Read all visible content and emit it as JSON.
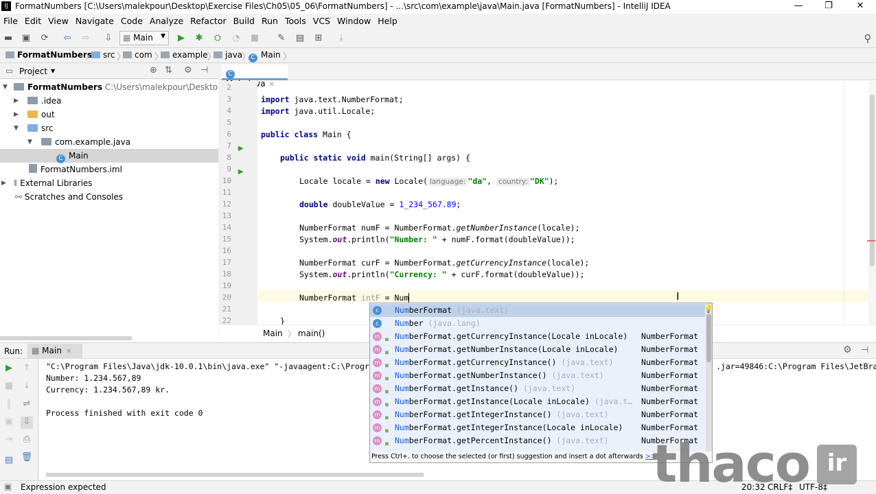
{
  "window": {
    "title": "FormatNumbers [C:\\Users\\malekpour\\Desktop\\Exercise Files\\Ch05\\05_06\\FormatNumbers] - ...\\src\\com\\example\\java\\Main.java [FormatNumbers] - IntelliJ IDEA",
    "app_icon": "IJ",
    "minimize": "—",
    "maximize": "❐",
    "close": "✕"
  },
  "menu": [
    "File",
    "Edit",
    "View",
    "Navigate",
    "Code",
    "Analyze",
    "Refactor",
    "Build",
    "Run",
    "Tools",
    "VCS",
    "Window",
    "Help"
  ],
  "toolbar": {
    "run_config": "Main"
  },
  "breadcrumb": [
    "FormatNumbers",
    "src",
    "com",
    "example",
    "java",
    "Main"
  ],
  "project": {
    "header": "Project",
    "tree": [
      {
        "label": "FormatNumbers",
        "path": "C:\\Users\\malekpour\\Desktop\\Exerc"
      },
      {
        "label": ".idea"
      },
      {
        "label": "out"
      },
      {
        "label": "src"
      },
      {
        "label": "com.example.java"
      },
      {
        "label": "Main"
      },
      {
        "label": "FormatNumbers.iml"
      },
      {
        "label": "External Libraries"
      },
      {
        "label": "Scratches and Consoles"
      }
    ]
  },
  "editor": {
    "tab": "Main.java",
    "line_numbers": [
      "2",
      "3",
      "4",
      "5",
      "6",
      "7",
      "8",
      "9",
      "10",
      "11",
      "12",
      "13",
      "14",
      "15",
      "16",
      "17",
      "18",
      "19",
      "20",
      "21",
      "22"
    ],
    "code": {
      "l3a": "import",
      "l3b": " java.text.NumberFormat;",
      "l4a": "import",
      "l4b": " java.util.Locale;",
      "l6a": "public class",
      "l6b": " Main {",
      "l8a": "public static void",
      "l8b": " main(String[] args) {",
      "l10a": "Locale locale = ",
      "l10b": "new",
      "l10c": " Locale(",
      "l10h1": "language:",
      "l10s1": "\"da\"",
      "l10d": ", ",
      "l10h2": "country:",
      "l10s2": "\"DK\"",
      "l10e": ");",
      "l12a": "double",
      "l12b": " doubleValue = ",
      "l12c": "1_234_567.89",
      "l12d": ";",
      "l14a": "NumberFormat numF = NumberFormat.",
      "l14b": "getNumberInstance",
      "l14c": "(locale);",
      "l15a": "System.",
      "l15b": "out",
      "l15c": ".println(",
      "l15d": "\"Number: \"",
      "l15e": " + numF.format(doubleValue));",
      "l17a": "NumberFormat curF = NumberFormat.",
      "l17b": "getCurrencyInstance",
      "l17c": "(locale);",
      "l18a": "System.",
      "l18b": "out",
      "l18c": ".println(",
      "l18d": "\"Currency: \"",
      "l18e": " + curF.format(doubleValue));",
      "l20a": "NumberFormat ",
      "l20b": "intF",
      "l20c": " = Num",
      "l22": "}"
    },
    "crumb": [
      "Main",
      "main()"
    ]
  },
  "completion": {
    "items": [
      {
        "hl": "Num",
        "rest": "berFormat",
        "tail": " (java.text)",
        "type": "",
        "icon": "c"
      },
      {
        "hl": "Num",
        "rest": "ber",
        "tail": " (java.lang)",
        "type": "",
        "icon": "c"
      },
      {
        "hl": "Num",
        "rest": "berFormat.getCurrencyInstance(Locale inLocale)",
        "tail": "",
        "type": "NumberFormat",
        "icon": "m"
      },
      {
        "hl": "Num",
        "rest": "berFormat.getNumberInstance(Locale inLocale)",
        "tail": "",
        "type": "NumberFormat",
        "icon": "m"
      },
      {
        "hl": "Num",
        "rest": "berFormat.getCurrencyInstance()",
        "tail": " (java.text)",
        "type": "NumberFormat",
        "icon": "m"
      },
      {
        "hl": "Num",
        "rest": "berFormat.getNumberInstance()",
        "tail": " (java.text)",
        "type": "NumberFormat",
        "icon": "m"
      },
      {
        "hl": "Num",
        "rest": "berFormat.getInstance()",
        "tail": " (java.text)",
        "type": "NumberFormat",
        "icon": "m"
      },
      {
        "hl": "Num",
        "rest": "berFormat.getInstance(Locale inLocale)",
        "tail": " (java.t…",
        "type": "NumberFormat",
        "icon": "m"
      },
      {
        "hl": "Num",
        "rest": "berFormat.getIntegerInstance()",
        "tail": " (java.text)",
        "type": "NumberFormat",
        "icon": "m"
      },
      {
        "hl": "Num",
        "rest": "berFormat.getIntegerInstance(Locale inLocale)",
        "tail": "",
        "type": "NumberFormat",
        "icon": "m"
      },
      {
        "hl": "Num",
        "rest": "berFormat.getPercentInstance()",
        "tail": " (java.text)",
        "type": "NumberFormat",
        "icon": "m"
      }
    ],
    "footer": "Press Ctrl+. to choose the selected (or first) suggestion and insert a dot afterwards",
    "footer_link": ">>"
  },
  "run": {
    "label": "Run:",
    "tab": "Main",
    "lines": [
      "\"C:\\Program Files\\Java\\jdk-10.0.1\\bin\\java.exe\" \"-javaagent:C:\\Progr",
      "Number: 1.234.567,89",
      "Currency: 1.234.567,89 kr.",
      "",
      "Process finished with exit code 0"
    ],
    "right_fragment": ".jar=49846:C:\\Program Files\\JetBra"
  },
  "status": {
    "message": "Expression expected",
    "position": "20:32",
    "line_sep": "CRLF‡",
    "encoding": "UTF-8‡"
  },
  "watermark": {
    "text": "thaco",
    "suffix": "ir"
  }
}
